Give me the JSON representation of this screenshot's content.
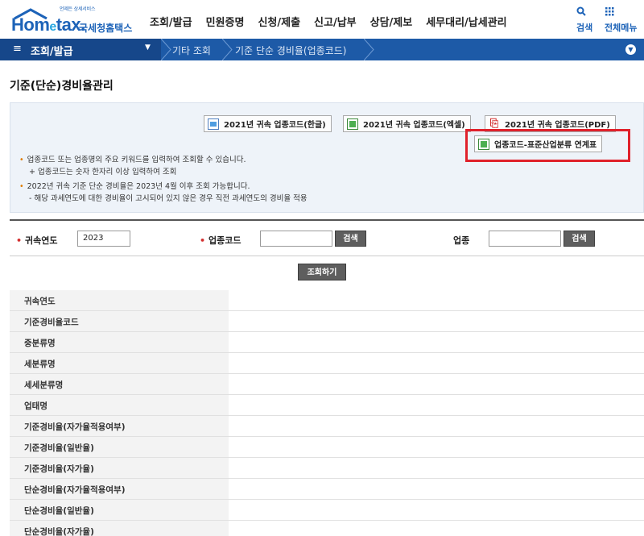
{
  "header": {
    "logo_tagline": "언제든 상세서비스",
    "logo_name_a": "Hom",
    "logo_name_e": "e",
    "logo_name_b": "tax.",
    "logo_kor": "국세청홈택스",
    "nav": [
      "조회/발급",
      "민원증명",
      "신청/제출",
      "신고/납부",
      "상담/제보",
      "세무대리/납세관리"
    ],
    "search_label": "검색",
    "allmenu_label": "전체메뉴"
  },
  "location": {
    "menu_label": "조회/발급",
    "crumbs": [
      "기타 조회",
      "기준 단순 경비율(업종코드)"
    ]
  },
  "page_title": "기준(단순)경비율관리",
  "downloads": {
    "hwp": "2021년 귀속 업종코드(한글)",
    "xls": "2021년 귀속 업종코드(엑셀)",
    "pdf": "2021년 귀속 업종코드(PDF)",
    "link": "업종코드-표준산업분류 연계표"
  },
  "notes": [
    "업종코드 또는 업종명의 주요 키워드를 입력하여 조회할 수 있습니다.",
    "+ 업종코드는 숫자 한자리 이상 입력하여 조회",
    "2022년 귀속 기준 단순 경비율은 2023년 4월 이후 조회 가능합니다.",
    "- 해당 과세연도에 대한 경비율이 고시되어 있지 않은 경우 직전 과세연도의 경비율 적용"
  ],
  "search": {
    "year_label": "귀속연도",
    "year_value": "2023",
    "code_label": "업종코드",
    "code_value": "",
    "code_search": "검색",
    "type_label": "업종",
    "type_value": "",
    "type_search": "검색",
    "submit": "조회하기"
  },
  "result_rows": [
    "귀속연도",
    "기준경비율코드",
    "중분류명",
    "세분류명",
    "세세분류명",
    "업태명",
    "기준경비율(자가율적용여부)",
    "기준경비율(일반율)",
    "기준경비율(자가율)",
    "단순경비율(자가율적용여부)",
    "단순경비율(일반율)",
    "단순경비율(자가율)"
  ]
}
